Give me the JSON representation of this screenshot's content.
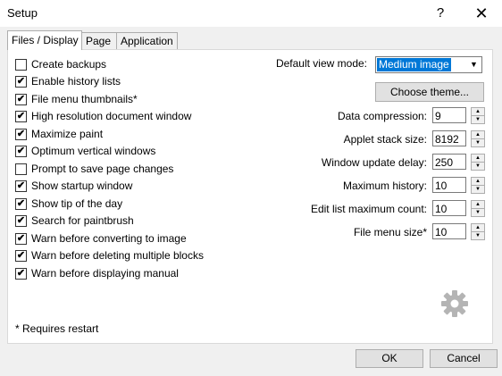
{
  "window": {
    "title": "Setup",
    "help_label": "?",
    "close_label": "✕"
  },
  "tabs": [
    "Files / Display",
    "Page",
    "Application"
  ],
  "checkboxes": [
    {
      "label": "Create backups",
      "checked": false
    },
    {
      "label": "Enable history lists",
      "checked": true
    },
    {
      "label": "File menu thumbnails*",
      "checked": true
    },
    {
      "label": "High resolution document window",
      "checked": true
    },
    {
      "label": "Maximize paint",
      "checked": true
    },
    {
      "label": "Optimum vertical windows",
      "checked": true
    },
    {
      "label": "Prompt to save page changes",
      "checked": false
    },
    {
      "label": "Show startup window",
      "checked": true
    },
    {
      "label": "Show tip of the day",
      "checked": true
    },
    {
      "label": "Search for paintbrush",
      "checked": true
    },
    {
      "label": "Warn before converting to image",
      "checked": true
    },
    {
      "label": "Warn before deleting multiple blocks",
      "checked": true
    },
    {
      "label": "Warn before displaying manual",
      "checked": true
    }
  ],
  "view_mode": {
    "label": "Default view mode:",
    "value": "Medium image"
  },
  "choose_theme_label": "Choose theme...",
  "settings": [
    {
      "label": "Data compression:",
      "value": "9"
    },
    {
      "label": "Applet stack size:",
      "value": "8192"
    },
    {
      "label": "Window update delay:",
      "value": "250"
    },
    {
      "label": "Maximum history:",
      "value": "10"
    },
    {
      "label": "Edit list maximum count:",
      "value": "10"
    },
    {
      "label": "File menu size*",
      "value": "10"
    }
  ],
  "footnote": "* Requires restart",
  "buttons": {
    "ok": "OK",
    "cancel": "Cancel"
  },
  "icons": {
    "gear": "gear-icon",
    "check": "✔",
    "spin_up": "▲",
    "spin_down": "▼",
    "dropdown": "▼"
  }
}
